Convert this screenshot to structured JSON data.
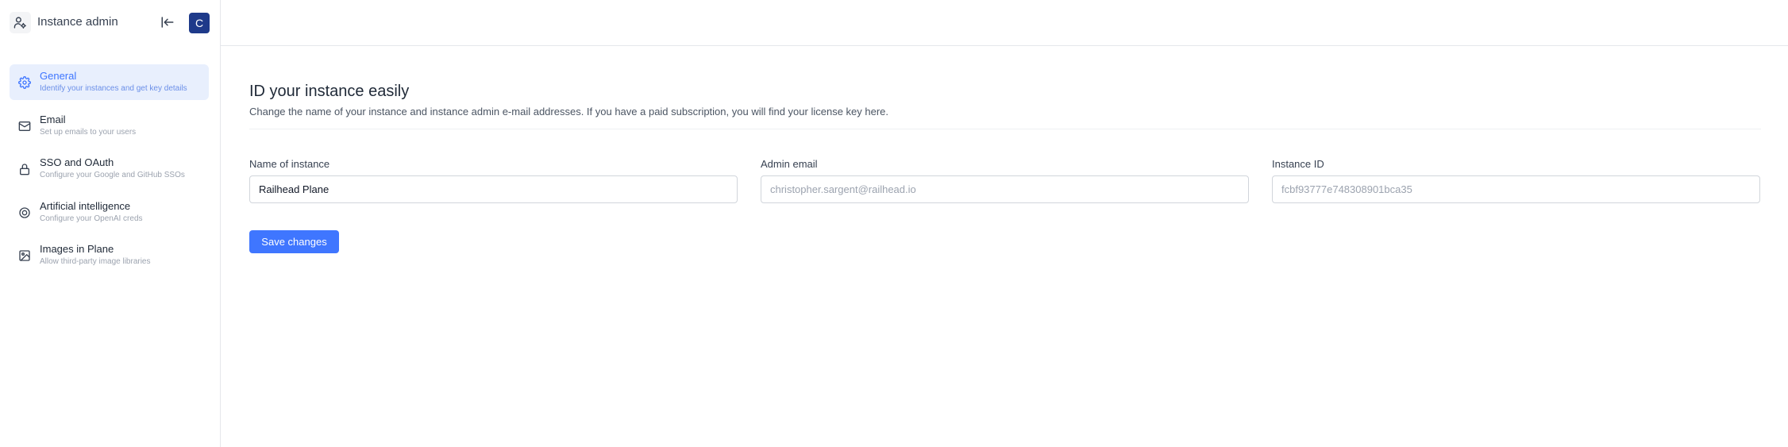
{
  "app": {
    "title": "Instance admin",
    "avatar_initial": "C"
  },
  "sidebar": {
    "items": [
      {
        "label": "General",
        "description": "Identify your instances and get key details",
        "icon": "gear-icon",
        "active": true
      },
      {
        "label": "Email",
        "description": "Set up emails to your users",
        "icon": "mail-icon",
        "active": false
      },
      {
        "label": "SSO and OAuth",
        "description": "Configure your Google and GitHub SSOs",
        "icon": "lock-icon",
        "active": false
      },
      {
        "label": "Artificial intelligence",
        "description": "Configure your OpenAI creds",
        "icon": "ai-icon",
        "active": false
      },
      {
        "label": "Images in Plane",
        "description": "Allow third-party image libraries",
        "icon": "image-icon",
        "active": false
      }
    ]
  },
  "main": {
    "title": "ID your instance easily",
    "subtitle": "Change the name of your instance and instance admin e-mail addresses. If you have a paid subscription, you will find your license key here.",
    "fields": {
      "instance_name": {
        "label": "Name of instance",
        "value": "Railhead Plane"
      },
      "admin_email": {
        "label": "Admin email",
        "value": "christopher.sargent@railhead.io"
      },
      "instance_id": {
        "label": "Instance ID",
        "value": "fcbf93777e748308901bca35"
      }
    },
    "save_label": "Save changes"
  },
  "colors": {
    "accent": "#3f76ff",
    "avatar_bg": "#1e3a8a",
    "active_bg": "#e8effd"
  }
}
